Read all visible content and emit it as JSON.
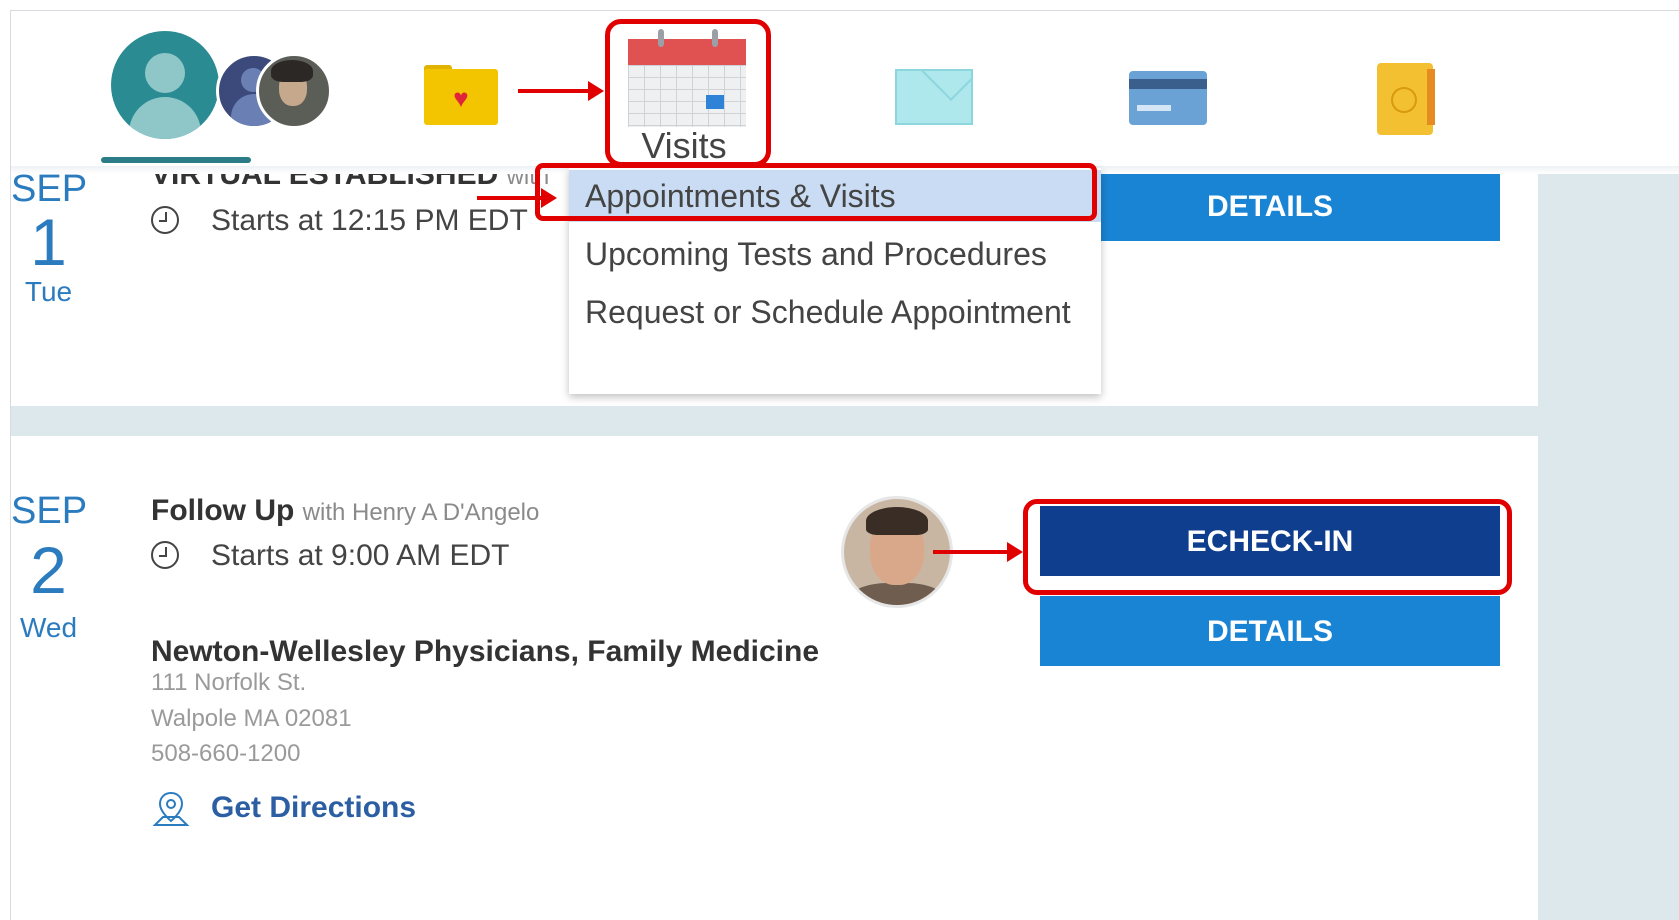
{
  "header": {
    "visits_label": "Visits"
  },
  "dropdown": {
    "items": [
      {
        "label": "Appointments & Visits"
      },
      {
        "label": "Upcoming Tests and Procedures"
      },
      {
        "label": "Request or Schedule Appointment"
      }
    ]
  },
  "appointments": [
    {
      "month": "SEP",
      "day": "1",
      "weekday": "Tue",
      "type": "VIRTUAL ESTABLISHED",
      "with_text": "with",
      "start": "Starts at 12:15 PM EDT",
      "details_label": "DETAILS"
    },
    {
      "month": "SEP",
      "day": "2",
      "weekday": "Wed",
      "type": "Follow Up",
      "with_text": "with Henry A D'Angelo",
      "start": "Starts at 9:00 AM EDT",
      "echeck_label": "ECHECK-IN",
      "details_label": "DETAILS",
      "location": {
        "name": "Newton-Wellesley Physicians, Family Medicine",
        "address1": "111 Norfolk St.",
        "address2": "Walpole MA 02081",
        "phone": "508-660-1200",
        "directions_label": "Get Directions"
      }
    }
  ],
  "colors": {
    "accent": "#1a84d4",
    "echeck": "#0f3e8e",
    "highlight": "#e00000",
    "date_text": "#2b7bbf"
  }
}
